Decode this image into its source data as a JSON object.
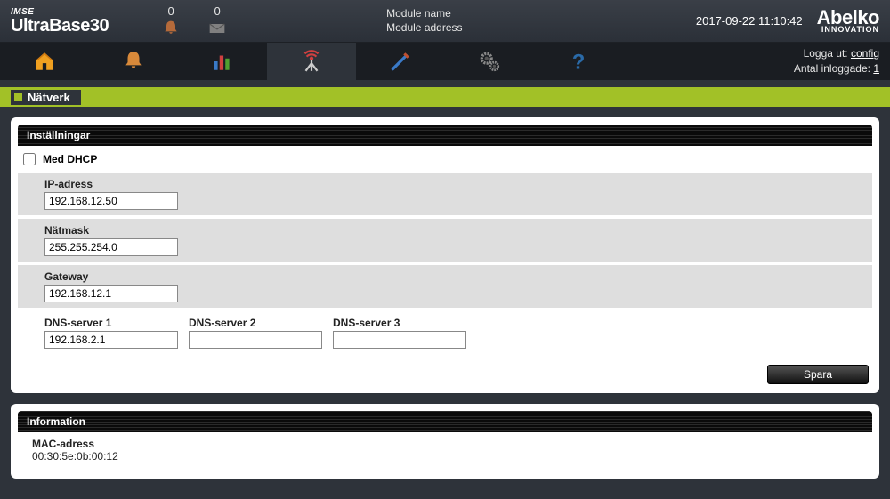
{
  "header": {
    "brand_top": "IMSE",
    "brand_name": "UltraBase30",
    "alarm_count": "0",
    "mail_count": "0",
    "module_name_label": "Module name",
    "module_address_label": "Module address",
    "timestamp": "2017-09-22 11:10:42",
    "logo_big": "Abelko",
    "logo_small": "INNOVATION"
  },
  "nav_right": {
    "logout_label": "Logga ut:",
    "logout_user": "config",
    "logged_in_label": "Antal inloggade:",
    "logged_in_count": "1"
  },
  "page": {
    "title": "Nätverk"
  },
  "settings": {
    "header": "Inställningar",
    "dhcp_label": "Med DHCP",
    "ip_label": "IP-adress",
    "ip_value": "192.168.12.50",
    "netmask_label": "Nätmask",
    "netmask_value": "255.255.254.0",
    "gateway_label": "Gateway",
    "gateway_value": "192.168.12.1",
    "dns1_label": "DNS-server 1",
    "dns1_value": "192.168.2.1",
    "dns2_label": "DNS-server 2",
    "dns2_value": "",
    "dns3_label": "DNS-server 3",
    "dns3_value": "",
    "save_label": "Spara"
  },
  "info": {
    "header": "Information",
    "mac_label": "MAC-adress",
    "mac_value": "00:30:5e:0b:00:12"
  }
}
